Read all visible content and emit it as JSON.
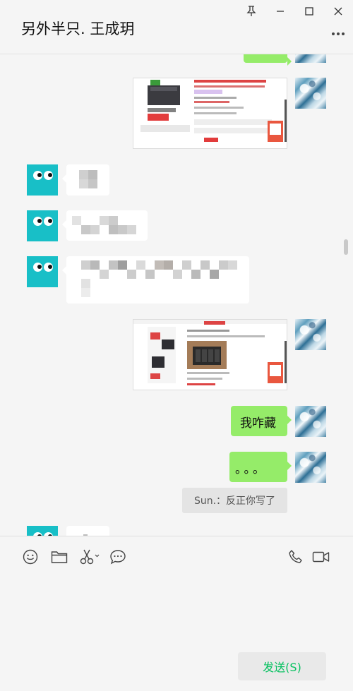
{
  "window": {
    "title": "另外半只. 王成玥"
  },
  "messages": {
    "mine_text_1": "我咋藏",
    "mine_text_2": "。。。",
    "system_recall": "Sun.：反正你写了"
  },
  "composer": {
    "send_label": "发送(S)"
  },
  "icons": {
    "pin": "pin-icon",
    "minimize": "minimize-icon",
    "maximize": "maximize-icon",
    "close": "close-icon",
    "more": "more-icon",
    "emoji": "emoji-icon",
    "folder": "folder-icon",
    "scissors": "scissors-icon",
    "chat": "chat-bubble-icon",
    "phone": "phone-icon",
    "video": "video-icon"
  },
  "colors": {
    "my_bubble": "#95ec69",
    "their_bubble": "#ffffff",
    "send_text": "#07c160",
    "background": "#f5f5f5"
  }
}
